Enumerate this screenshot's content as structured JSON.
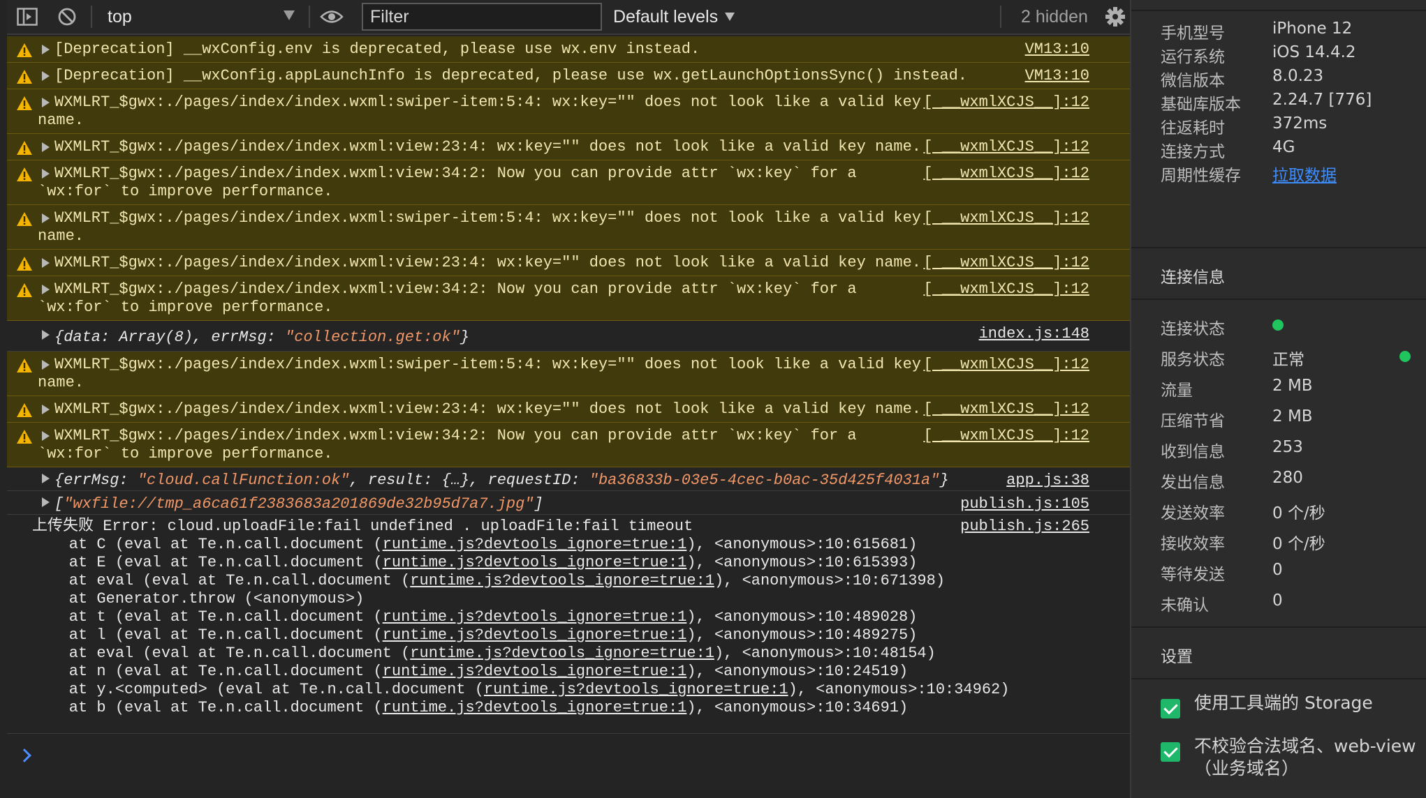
{
  "toolbar": {
    "context": "top",
    "filter_placeholder": "Filter",
    "levels": "Default levels",
    "hidden": "2 hidden"
  },
  "logs": [
    {
      "level": "warn",
      "expandable": true,
      "text": "[Deprecation] __wxConfig.env is deprecated, please use wx.env instead.",
      "source": "VM13:10"
    },
    {
      "level": "warn",
      "expandable": true,
      "text": "[Deprecation] __wxConfig.appLaunchInfo is deprecated, please use wx.getLaunchOptionsSync() instead.",
      "source": "VM13:10"
    },
    {
      "level": "warn",
      "expandable": true,
      "text": "WXMLRT_$gwx:./pages/index/index.wxml:swiper-item:5:4: wx:key=\"\" does not look like a valid key",
      "text2": "name.",
      "source": "[ __wxmlXCJS__]:12"
    },
    {
      "level": "warn",
      "expandable": true,
      "text": "WXMLRT_$gwx:./pages/index/index.wxml:view:23:4: wx:key=\"\" does not look like a valid key name.",
      "source": "[ __wxmlXCJS__]:12"
    },
    {
      "level": "warn",
      "expandable": true,
      "text": "WXMLRT_$gwx:./pages/index/index.wxml:view:34:2: Now you can provide attr `wx:key` for a",
      "text2": "`wx:for` to improve performance.",
      "source": "[ __wxmlXCJS__]:12"
    },
    {
      "level": "warn",
      "expandable": true,
      "text": "WXMLRT_$gwx:./pages/index/index.wxml:swiper-item:5:4: wx:key=\"\" does not look like a valid key",
      "text2": "name.",
      "source": "[ __wxmlXCJS__]:12"
    },
    {
      "level": "warn",
      "expandable": true,
      "text": "WXMLRT_$gwx:./pages/index/index.wxml:view:23:4: wx:key=\"\" does not look like a valid key name.",
      "source": "[ __wxmlXCJS__]:12"
    },
    {
      "level": "warn",
      "expandable": true,
      "text": "WXMLRT_$gwx:./pages/index/index.wxml:view:34:2: Now you can provide attr `wx:key` for a",
      "text2": "`wx:for` to improve performance.",
      "source": "[ __wxmlXCJS__]:12"
    },
    {
      "level": "log",
      "type": "obj1",
      "parts": [
        "{data: Array(8), errMsg: ",
        "\"collection.get:ok\"",
        "}"
      ],
      "source": "index.js:148"
    },
    {
      "level": "warn",
      "expandable": true,
      "text": "WXMLRT_$gwx:./pages/index/index.wxml:swiper-item:5:4: wx:key=\"\" does not look like a valid key",
      "text2": "name.",
      "source": "[ __wxmlXCJS__]:12"
    },
    {
      "level": "warn",
      "expandable": true,
      "text": "WXMLRT_$gwx:./pages/index/index.wxml:view:23:4: wx:key=\"\" does not look like a valid key name.",
      "source": "[ __wxmlXCJS__]:12"
    },
    {
      "level": "warn",
      "expandable": true,
      "text": "WXMLRT_$gwx:./pages/index/index.wxml:view:34:2: Now you can provide attr `wx:key` for a",
      "text2": "`wx:for` to improve performance.",
      "source": "[ __wxmlXCJS__]:12"
    },
    {
      "level": "log",
      "type": "obj2",
      "parts": [
        "{errMsg: ",
        "\"cloud.callFunction:ok\"",
        ", result: {…}, requestID: ",
        "\"ba36833b-03e5-4cec-b0ac-35d425f4031a\"",
        "}"
      ],
      "source": "app.js:38"
    },
    {
      "level": "log",
      "type": "obj3",
      "parts": [
        "[",
        "\"wxfile://tmp_a6ca61f2383683a201869de32b95d7a7.jpg\"",
        "]"
      ],
      "source": "publish.js:105"
    },
    {
      "level": "error",
      "type": "stack",
      "head": "上传失败 Error: cloud.uploadFile:fail undefined . uploadFile:fail timeout",
      "source": "publish.js:265",
      "frames": [
        {
          "pre": "    at C (eval at Te.n.call.document (",
          "link": "runtime.js?devtools_ignore=true:1",
          "post": "), <anonymous>:10:615681)"
        },
        {
          "pre": "    at E (eval at Te.n.call.document (",
          "link": "runtime.js?devtools_ignore=true:1",
          "post": "), <anonymous>:10:615393)"
        },
        {
          "pre": "    at eval (eval at Te.n.call.document (",
          "link": "runtime.js?devtools_ignore=true:1",
          "post": "), <anonymous>:10:671398)"
        },
        {
          "pre": "    at Generator.throw (<anonymous>)",
          "link": "",
          "post": ""
        },
        {
          "pre": "    at t (eval at Te.n.call.document (",
          "link": "runtime.js?devtools_ignore=true:1",
          "post": "), <anonymous>:10:489028)"
        },
        {
          "pre": "    at l (eval at Te.n.call.document (",
          "link": "runtime.js?devtools_ignore=true:1",
          "post": "), <anonymous>:10:489275)"
        },
        {
          "pre": "    at eval (eval at Te.n.call.document (",
          "link": "runtime.js?devtools_ignore=true:1",
          "post": "), <anonymous>:10:48154)"
        },
        {
          "pre": "    at n (eval at Te.n.call.document (",
          "link": "runtime.js?devtools_ignore=true:1",
          "post": "), <anonymous>:10:24519)"
        },
        {
          "pre": "    at y.<computed> (eval at Te.n.call.document (",
          "link": "runtime.js?devtools_ignore=true:1",
          "post": "), <anonymous>:10:34962)"
        },
        {
          "pre": "    at b (eval at Te.n.call.document (",
          "link": "runtime.js?devtools_ignore=true:1",
          "post": "), <anonymous>:10:34691)"
        }
      ]
    }
  ],
  "device": [
    {
      "k": "手机型号",
      "v": "iPhone 12"
    },
    {
      "k": "运行系统",
      "v": "iOS 14.4.2"
    },
    {
      "k": "微信版本",
      "v": "8.0.23"
    },
    {
      "k": "基础库版本",
      "v": "2.24.7 [776]"
    },
    {
      "k": "往返耗时",
      "v": "372ms"
    },
    {
      "k": "连接方式",
      "v": "4G"
    },
    {
      "k": "周期性缓存",
      "v": "拉取数据",
      "link": true
    }
  ],
  "connection": {
    "title": "连接信息",
    "status_label": "连接状态",
    "service_label": "服务状态",
    "service_value": "正常",
    "status_color": "#21c55d",
    "stats": [
      {
        "k": "流量",
        "v": "2 MB"
      },
      {
        "k": "压缩节省",
        "v": "2 MB"
      },
      {
        "k": "收到信息",
        "v": "253"
      },
      {
        "k": "发出信息",
        "v": "280"
      },
      {
        "k": "发送效率",
        "v": "0 个/秒"
      },
      {
        "k": "接收效率",
        "v": "0 个/秒"
      },
      {
        "k": "等待发送",
        "v": "0"
      },
      {
        "k": "未确认",
        "v": "0"
      }
    ]
  },
  "settings": {
    "title": "设置",
    "options": [
      {
        "label": "使用工具端的 Storage",
        "checked": true
      },
      {
        "label": "不校验合法域名、web-view（业务域名）",
        "checked": true
      }
    ]
  }
}
